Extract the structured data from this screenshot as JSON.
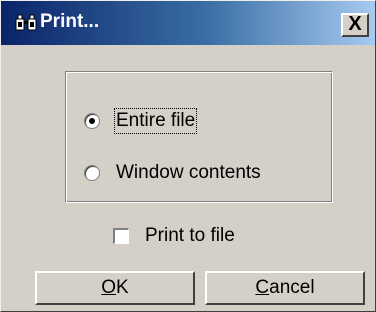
{
  "window": {
    "title": "Print...",
    "title_icon": "binoculars-icon",
    "close_label": "X"
  },
  "print_range": {
    "options": [
      {
        "label": "Entire file",
        "selected": true
      },
      {
        "label": "Window contents",
        "selected": false
      }
    ]
  },
  "print_to_file": {
    "label": "Print to file",
    "checked": false
  },
  "buttons": {
    "ok": {
      "mnemonic": "O",
      "rest": "K"
    },
    "cancel": {
      "mnemonic": "C",
      "rest": "ancel"
    }
  },
  "colors": {
    "titlebar_start": "#0a246a",
    "titlebar_end": "#a6caf0",
    "face": "#d4d0c8"
  }
}
